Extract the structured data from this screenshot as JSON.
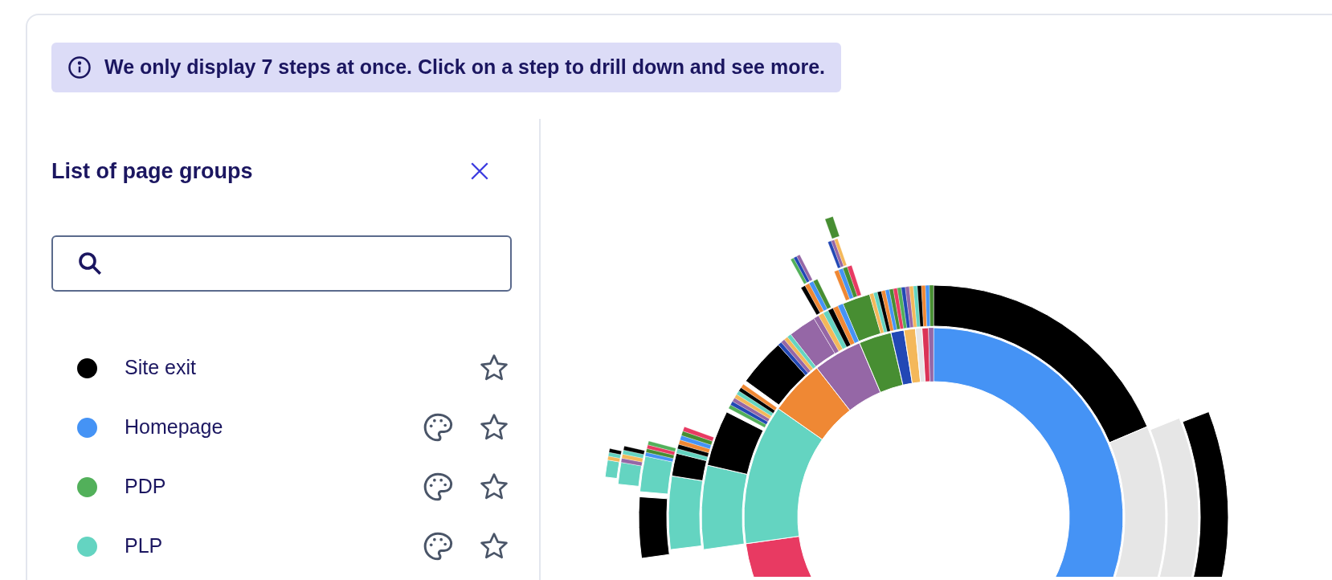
{
  "banner": {
    "text": "We only display 7 steps at once. Click on a step to drill down and see more."
  },
  "panel": {
    "title": "List of page groups"
  },
  "page_groups": [
    {
      "name": "Site exit",
      "color": "#000000",
      "customizable": false,
      "starred": false
    },
    {
      "name": "Homepage",
      "color": "#4593f5",
      "customizable": true,
      "starred": false
    },
    {
      "name": "PDP",
      "color": "#52b05a",
      "customizable": true,
      "starred": false
    },
    {
      "name": "PLP",
      "color": "#64d4c1",
      "customizable": true,
      "starred": false
    }
  ]
}
